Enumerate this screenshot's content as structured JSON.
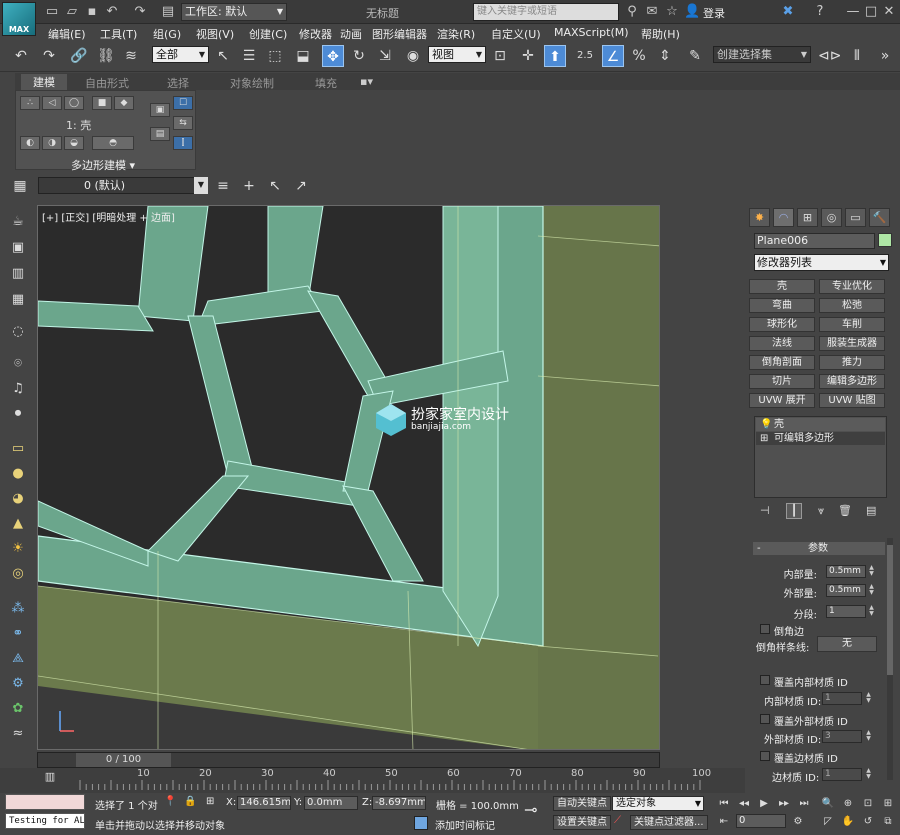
{
  "app": {
    "logo_text": "MAX",
    "workspace_label": "工作区: 默认",
    "doc_title": "无标题",
    "search_placeholder": "键入关键字或短语",
    "login": "登录"
  },
  "menu": [
    "编辑(E)",
    "工具(T)",
    "组(G)",
    "视图(V)",
    "创建(C)",
    "修改器",
    "动画",
    "图形编辑器",
    "渲染(R)",
    "自定义(U)",
    "MAXScript(M)",
    "帮助(H)"
  ],
  "toolbar": {
    "selection_filter": "全部",
    "ref_coord": "视图",
    "snap_value": "2.5",
    "named_selection": "创建选择集"
  },
  "ribbon": {
    "tabs": [
      "建模",
      "自由形式",
      "选择",
      "对象绘制",
      "填充"
    ],
    "active_tab": "建模",
    "sub_label": "1: 壳",
    "panel_label": "多边形建模 ▾"
  },
  "layer": {
    "name": "0 (默认)"
  },
  "viewport": {
    "label": "[+] [正交] [明暗处理 + 边面]",
    "watermark_title": "扮家家室内设计",
    "watermark_sub": "banjiajia.com"
  },
  "command_panel": {
    "object_name": "Plane006",
    "object_color": "#aee6a5",
    "modifier_list": "修改器列表",
    "modifier_buttons": [
      "壳",
      "专业优化",
      "弯曲",
      "松弛",
      "球形化",
      "车削",
      "法线",
      "服装生成器",
      "倒角剖面",
      "推力",
      "切片",
      "编辑多边形",
      "UVW 展开",
      "UVW 贴图"
    ],
    "stack": [
      "壳",
      "可编辑多边形"
    ],
    "params_title": "参数",
    "inner_label": "内部量:",
    "inner_value": "0.5mm",
    "outer_label": "外部量:",
    "outer_value": "0.5mm",
    "segments_label": "分段:",
    "segments_value": "1",
    "bevel_edges": "倒角边",
    "bevel_spline_label": "倒角样条线:",
    "bevel_spline_value": "无",
    "override_inner_mat": "覆盖内部材质 ID",
    "inner_mat_label": "内部材质 ID:",
    "inner_mat_value": "1",
    "override_outer_mat": "覆盖外部材质 ID",
    "outer_mat_label": "外部材质 ID:",
    "outer_mat_value": "3",
    "override_edge_mat": "覆盖边材质 ID",
    "edge_mat_label": "边材质 ID:",
    "edge_mat_value": "1"
  },
  "timeline": {
    "slider_label": "0 / 100",
    "ticks": [
      "10",
      "20",
      "30",
      "40",
      "50",
      "60",
      "70",
      "80",
      "90",
      "100"
    ]
  },
  "status": {
    "testing": "Testing for AL",
    "selected": "选择了 1 个对",
    "prompt": "单击并拖动以选择并移动对象",
    "x_label": "X:",
    "x_value": "146.615mm",
    "y_label": "Y:",
    "y_value": "0.0mm",
    "z_label": "Z:",
    "z_value": "-8.697mm",
    "grid": "栅格 = 100.0mm",
    "add_time_tag": "添加时间标记",
    "auto_key": "自动关键点",
    "set_key": "设置关键点",
    "key_mode": "选定对象",
    "key_filters": "关键点过滤器...",
    "frame": "0"
  }
}
